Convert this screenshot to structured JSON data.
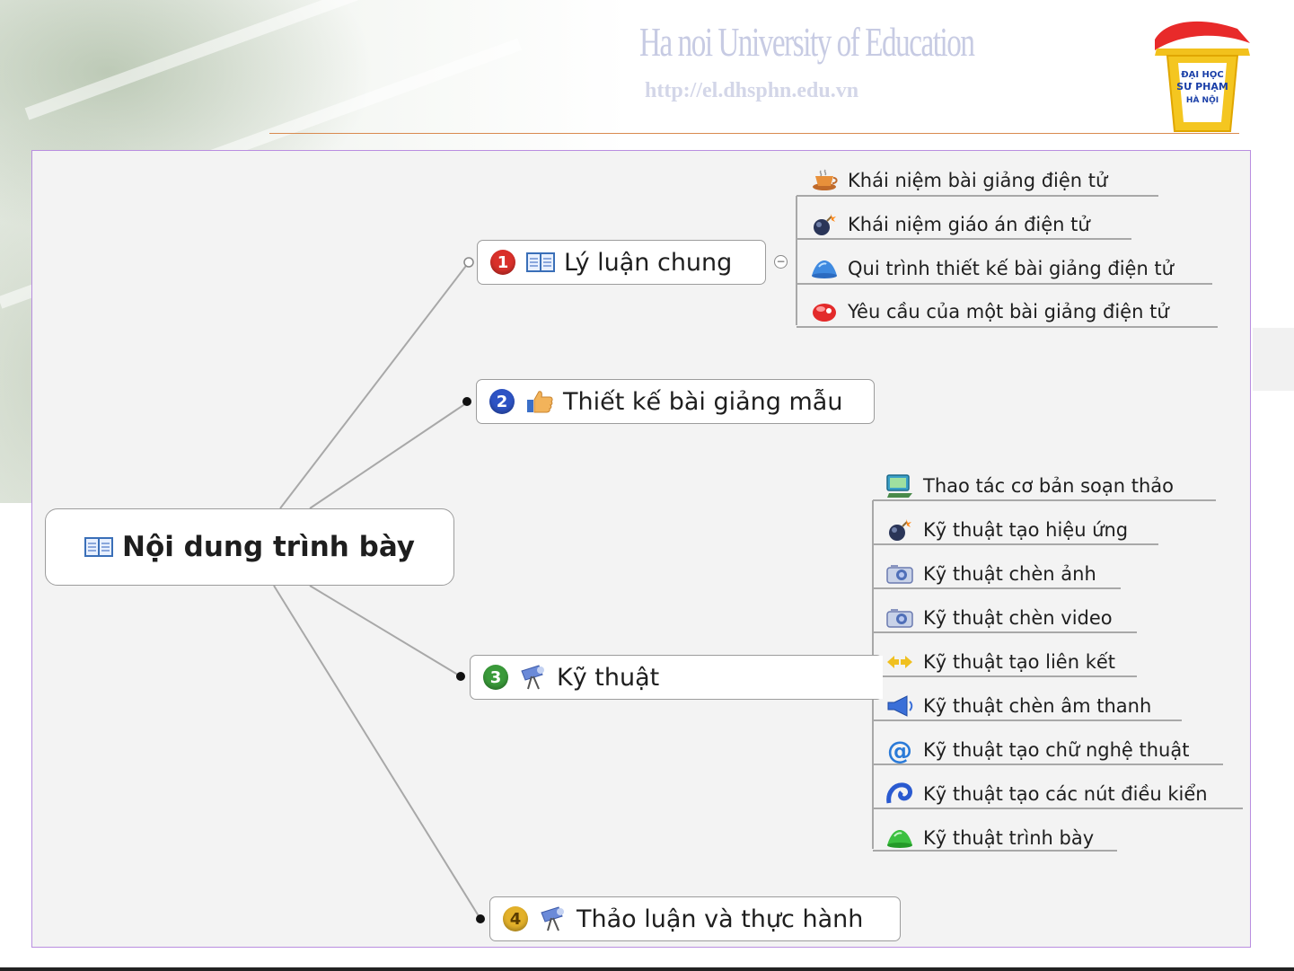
{
  "header": {
    "university": "Ha noi University of Education",
    "url": "http://el.dhsphn.edu.vn",
    "logo_text": [
      "ĐẠI HỌC",
      "SƯ PHẠM",
      "HÀ NỘI"
    ]
  },
  "colors": {
    "frame_border": "#b98ee0",
    "badge_1": "#d9302a",
    "badge_2": "#2d53c4",
    "badge_3": "#3a9a3a",
    "badge_4": "#e3b12a"
  },
  "mindmap": {
    "central": {
      "label": "Nội dung trình bày",
      "icon": "book-icon"
    },
    "branches": [
      {
        "number": "1",
        "label": "Lý luận chung",
        "icon": "book-icon",
        "children": [
          {
            "label": "Khái niệm bài giảng điện tử",
            "icon": "coffee-cup-icon"
          },
          {
            "label": "Khái niệm giáo án điện tử",
            "icon": "bomb-icon"
          },
          {
            "label": "Qui trình thiết kế bài giảng điện tử",
            "icon": "blue-triangle-icon"
          },
          {
            "label": "Yêu cầu của một bài giảng điện tử",
            "icon": "red-ball-icon"
          }
        ]
      },
      {
        "number": "2",
        "label": "Thiết kế bài giảng mẫu",
        "icon": "thumbs-up-icon",
        "children": []
      },
      {
        "number": "3",
        "label": "Kỹ thuật",
        "icon": "telescope-icon",
        "children": [
          {
            "label": "Thao tác cơ bản soạn thảo",
            "icon": "monitor-icon"
          },
          {
            "label": "Kỹ thuật tạo hiệu ứng",
            "icon": "bomb-icon"
          },
          {
            "label": "Kỹ thuật chèn ảnh",
            "icon": "camera-icon"
          },
          {
            "label": "Kỹ thuật chèn video",
            "icon": "camera-icon"
          },
          {
            "label": "Kỹ thuật tạo liên kết",
            "icon": "arrows-icon"
          },
          {
            "label": "Kỹ thuật chèn âm thanh",
            "icon": "megaphone-icon"
          },
          {
            "label": "Kỹ thuật tạo chữ nghệ thuật",
            "icon": "at-sign-icon"
          },
          {
            "label": "Kỹ thuật tạo các nút điều kiển",
            "icon": "swirl-icon"
          },
          {
            "label": "Kỹ thuật trình bày",
            "icon": "green-triangle-icon"
          }
        ]
      },
      {
        "number": "4",
        "label": "Thảo luận và thực hành",
        "icon": "telescope-icon",
        "children": []
      }
    ]
  }
}
